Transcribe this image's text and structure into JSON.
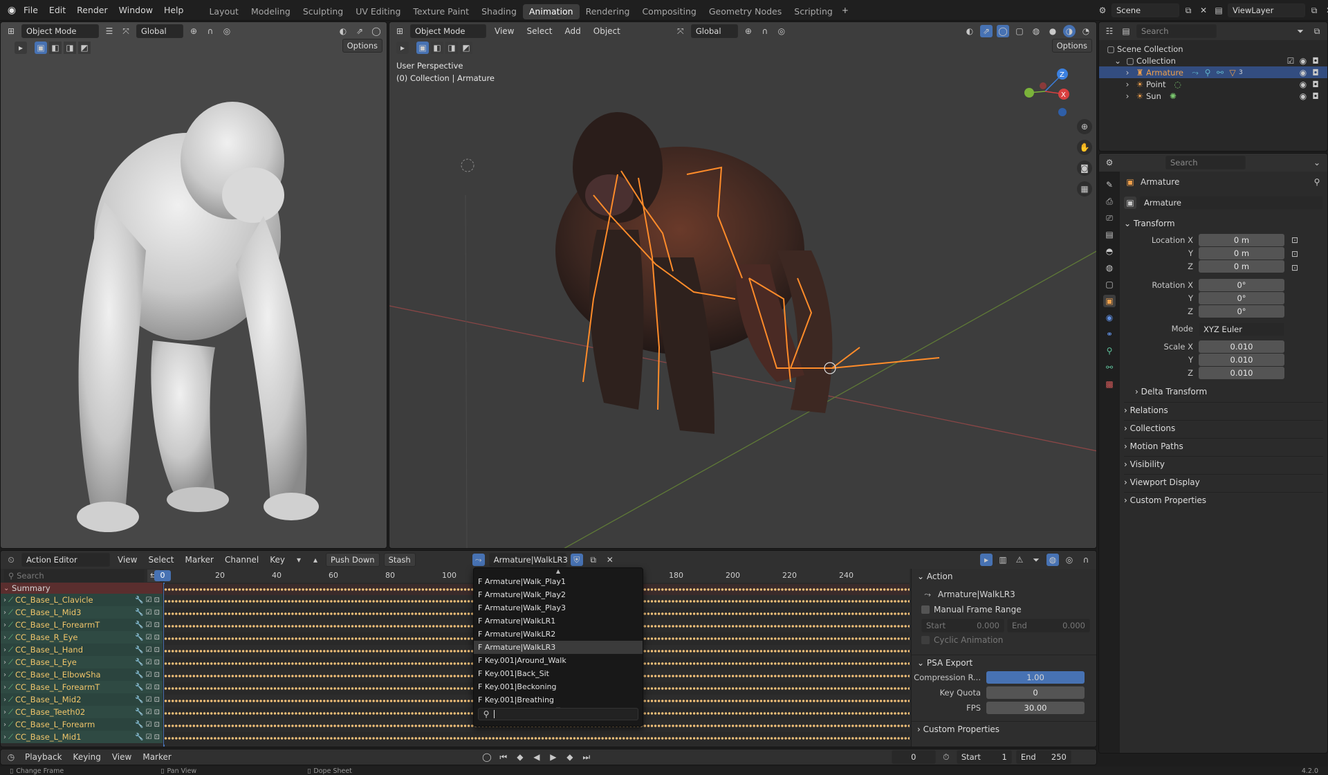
{
  "topbar": {
    "menus": [
      "File",
      "Edit",
      "Render",
      "Window",
      "Help"
    ],
    "workspaces": [
      "Layout",
      "Modeling",
      "Sculpting",
      "UV Editing",
      "Texture Paint",
      "Shading",
      "Animation",
      "Rendering",
      "Compositing",
      "Geometry Nodes",
      "Scripting"
    ],
    "active_workspace": "Animation",
    "add_icon": "+",
    "scene": "Scene",
    "view_layer": "ViewLayer"
  },
  "left_viewport": {
    "mode": "Object Mode",
    "orientation": "Global",
    "options": "Options"
  },
  "main_viewport": {
    "mode": "Object Mode",
    "menus": [
      "View",
      "Select",
      "Add",
      "Object"
    ],
    "orientation": "Global",
    "options": "Options",
    "overlay_title": "User Perspective",
    "overlay_sub": "(0) Collection | Armature",
    "gizmo": {
      "z": "Z",
      "x": "X"
    }
  },
  "outliner": {
    "search_placeholder": "Search",
    "scene_collection": "Scene Collection",
    "collection": "Collection",
    "items": [
      {
        "name": "Armature",
        "color": "#f0a04b",
        "selected": true
      },
      {
        "name": "Point",
        "color": "#d8d8d8",
        "selected": false
      },
      {
        "name": "Sun",
        "color": "#d8d8d8",
        "selected": false
      }
    ],
    "armature_badge": "3"
  },
  "properties": {
    "search_placeholder": "Search",
    "object_name": "Armature",
    "data_name": "Armature",
    "transform_title": "Transform",
    "location": {
      "label": "Location X",
      "x": "0 m",
      "y": "0 m",
      "z": "0 m"
    },
    "rotation": {
      "label": "Rotation X",
      "x": "0°",
      "y": "0°",
      "z": "0°"
    },
    "mode": {
      "label": "Mode",
      "value": "XYZ Euler"
    },
    "scale": {
      "label": "Scale X",
      "x": "0.010",
      "y": "0.010",
      "z": "0.010"
    },
    "axis_y": "Y",
    "axis_z": "Z",
    "delta": "Delta Transform",
    "sections": [
      "Relations",
      "Collections",
      "Motion Paths",
      "Visibility",
      "Viewport Display",
      "Custom Properties"
    ]
  },
  "action_editor": {
    "mode": "Action Editor",
    "menus": [
      "View",
      "Select",
      "Marker",
      "Channel",
      "Key"
    ],
    "push_down": "Push Down",
    "stash": "Stash",
    "action_name": "Armature|WalkLR3",
    "search_placeholder": "Search",
    "summary": "Summary",
    "ruler": [
      "20",
      "40",
      "60",
      "80",
      "100",
      "180",
      "200",
      "220",
      "240"
    ],
    "current_frame": "0",
    "channels": [
      "CC_Base_L_Clavicle",
      "CC_Base_L_Mid3",
      "CC_Base_L_ForearmT",
      "CC_Base_R_Eye",
      "CC_Base_L_Hand",
      "CC_Base_L_Eye",
      "CC_Base_L_ElbowSha",
      "CC_Base_L_ForearmT",
      "CC_Base_L_Mid2",
      "CC_Base_Teeth02",
      "CC_Base_L_Forearm",
      "CC_Base_L_Mid1"
    ]
  },
  "action_dropdown": {
    "items": [
      "F Armature|Walk_Play1",
      "F Armature|Walk_Play2",
      "F Armature|Walk_Play3",
      "F Armature|WalkLR1",
      "F Armature|WalkLR2",
      "F Armature|WalkLR3",
      "F Key.001|Around_Walk",
      "F Key.001|Back_Sit",
      "F Key.001|Beckoning",
      "F Key.001|Breathing"
    ],
    "selected": "F Armature|WalkLR3"
  },
  "action_sidebar": {
    "action_title": "Action",
    "action_name": "Armature|WalkLR3",
    "manual_frame_range": "Manual Frame Range",
    "start_label": "Start",
    "start_value": "0.000",
    "end_label": "End",
    "end_value": "0.000",
    "cyclic": "Cyclic Animation",
    "psa_title": "PSA Export",
    "compression_label": "Compression R...",
    "compression_value": "1.00",
    "compression_fraction": 1.0,
    "key_quota_label": "Key Quota",
    "key_quota_value": "0",
    "fps_label": "FPS",
    "fps_value": "30.00",
    "custom_props": "Custom Properties"
  },
  "timeline": {
    "menus": [
      "Playback",
      "Keying",
      "View",
      "Marker"
    ],
    "frame": "0",
    "start_label": "Start",
    "start_value": "1",
    "end_label": "End",
    "end_value": "250"
  },
  "statusbar": {
    "items": [
      "Change Frame",
      "Pan View",
      "Dope Sheet"
    ],
    "version": "4.2.0"
  }
}
